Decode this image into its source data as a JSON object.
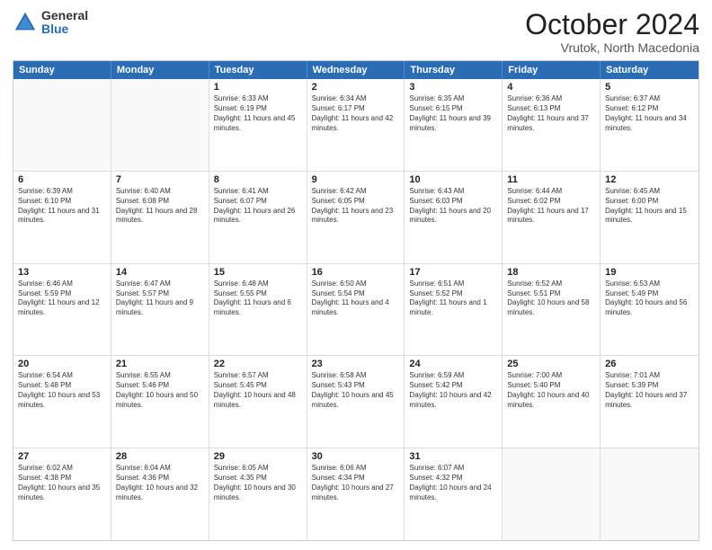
{
  "header": {
    "logo_general": "General",
    "logo_blue": "Blue",
    "title": "October 2024",
    "subtitle": "Vrutok, North Macedonia"
  },
  "calendar": {
    "days": [
      "Sunday",
      "Monday",
      "Tuesday",
      "Wednesday",
      "Thursday",
      "Friday",
      "Saturday"
    ],
    "rows": [
      [
        {
          "day": "",
          "empty": true
        },
        {
          "day": "",
          "empty": true
        },
        {
          "day": "1",
          "sunrise": "Sunrise: 6:33 AM",
          "sunset": "Sunset: 6:19 PM",
          "daylight": "Daylight: 11 hours and 45 minutes."
        },
        {
          "day": "2",
          "sunrise": "Sunrise: 6:34 AM",
          "sunset": "Sunset: 6:17 PM",
          "daylight": "Daylight: 11 hours and 42 minutes."
        },
        {
          "day": "3",
          "sunrise": "Sunrise: 6:35 AM",
          "sunset": "Sunset: 6:15 PM",
          "daylight": "Daylight: 11 hours and 39 minutes."
        },
        {
          "day": "4",
          "sunrise": "Sunrise: 6:36 AM",
          "sunset": "Sunset: 6:13 PM",
          "daylight": "Daylight: 11 hours and 37 minutes."
        },
        {
          "day": "5",
          "sunrise": "Sunrise: 6:37 AM",
          "sunset": "Sunset: 6:12 PM",
          "daylight": "Daylight: 11 hours and 34 minutes."
        }
      ],
      [
        {
          "day": "6",
          "sunrise": "Sunrise: 6:39 AM",
          "sunset": "Sunset: 6:10 PM",
          "daylight": "Daylight: 11 hours and 31 minutes."
        },
        {
          "day": "7",
          "sunrise": "Sunrise: 6:40 AM",
          "sunset": "Sunset: 6:08 PM",
          "daylight": "Daylight: 11 hours and 28 minutes."
        },
        {
          "day": "8",
          "sunrise": "Sunrise: 6:41 AM",
          "sunset": "Sunset: 6:07 PM",
          "daylight": "Daylight: 11 hours and 26 minutes."
        },
        {
          "day": "9",
          "sunrise": "Sunrise: 6:42 AM",
          "sunset": "Sunset: 6:05 PM",
          "daylight": "Daylight: 11 hours and 23 minutes."
        },
        {
          "day": "10",
          "sunrise": "Sunrise: 6:43 AM",
          "sunset": "Sunset: 6:03 PM",
          "daylight": "Daylight: 11 hours and 20 minutes."
        },
        {
          "day": "11",
          "sunrise": "Sunrise: 6:44 AM",
          "sunset": "Sunset: 6:02 PM",
          "daylight": "Daylight: 11 hours and 17 minutes."
        },
        {
          "day": "12",
          "sunrise": "Sunrise: 6:45 AM",
          "sunset": "Sunset: 6:00 PM",
          "daylight": "Daylight: 11 hours and 15 minutes."
        }
      ],
      [
        {
          "day": "13",
          "sunrise": "Sunrise: 6:46 AM",
          "sunset": "Sunset: 5:59 PM",
          "daylight": "Daylight: 11 hours and 12 minutes."
        },
        {
          "day": "14",
          "sunrise": "Sunrise: 6:47 AM",
          "sunset": "Sunset: 5:57 PM",
          "daylight": "Daylight: 11 hours and 9 minutes."
        },
        {
          "day": "15",
          "sunrise": "Sunrise: 6:48 AM",
          "sunset": "Sunset: 5:55 PM",
          "daylight": "Daylight: 11 hours and 6 minutes."
        },
        {
          "day": "16",
          "sunrise": "Sunrise: 6:50 AM",
          "sunset": "Sunset: 5:54 PM",
          "daylight": "Daylight: 11 hours and 4 minutes."
        },
        {
          "day": "17",
          "sunrise": "Sunrise: 6:51 AM",
          "sunset": "Sunset: 5:52 PM",
          "daylight": "Daylight: 11 hours and 1 minute."
        },
        {
          "day": "18",
          "sunrise": "Sunrise: 6:52 AM",
          "sunset": "Sunset: 5:51 PM",
          "daylight": "Daylight: 10 hours and 58 minutes."
        },
        {
          "day": "19",
          "sunrise": "Sunrise: 6:53 AM",
          "sunset": "Sunset: 5:49 PM",
          "daylight": "Daylight: 10 hours and 56 minutes."
        }
      ],
      [
        {
          "day": "20",
          "sunrise": "Sunrise: 6:54 AM",
          "sunset": "Sunset: 5:48 PM",
          "daylight": "Daylight: 10 hours and 53 minutes."
        },
        {
          "day": "21",
          "sunrise": "Sunrise: 6:55 AM",
          "sunset": "Sunset: 5:46 PM",
          "daylight": "Daylight: 10 hours and 50 minutes."
        },
        {
          "day": "22",
          "sunrise": "Sunrise: 6:57 AM",
          "sunset": "Sunset: 5:45 PM",
          "daylight": "Daylight: 10 hours and 48 minutes."
        },
        {
          "day": "23",
          "sunrise": "Sunrise: 6:58 AM",
          "sunset": "Sunset: 5:43 PM",
          "daylight": "Daylight: 10 hours and 45 minutes."
        },
        {
          "day": "24",
          "sunrise": "Sunrise: 6:59 AM",
          "sunset": "Sunset: 5:42 PM",
          "daylight": "Daylight: 10 hours and 42 minutes."
        },
        {
          "day": "25",
          "sunrise": "Sunrise: 7:00 AM",
          "sunset": "Sunset: 5:40 PM",
          "daylight": "Daylight: 10 hours and 40 minutes."
        },
        {
          "day": "26",
          "sunrise": "Sunrise: 7:01 AM",
          "sunset": "Sunset: 5:39 PM",
          "daylight": "Daylight: 10 hours and 37 minutes."
        }
      ],
      [
        {
          "day": "27",
          "sunrise": "Sunrise: 6:02 AM",
          "sunset": "Sunset: 4:38 PM",
          "daylight": "Daylight: 10 hours and 35 minutes."
        },
        {
          "day": "28",
          "sunrise": "Sunrise: 6:04 AM",
          "sunset": "Sunset: 4:36 PM",
          "daylight": "Daylight: 10 hours and 32 minutes."
        },
        {
          "day": "29",
          "sunrise": "Sunrise: 6:05 AM",
          "sunset": "Sunset: 4:35 PM",
          "daylight": "Daylight: 10 hours and 30 minutes."
        },
        {
          "day": "30",
          "sunrise": "Sunrise: 6:06 AM",
          "sunset": "Sunset: 4:34 PM",
          "daylight": "Daylight: 10 hours and 27 minutes."
        },
        {
          "day": "31",
          "sunrise": "Sunrise: 6:07 AM",
          "sunset": "Sunset: 4:32 PM",
          "daylight": "Daylight: 10 hours and 24 minutes."
        },
        {
          "day": "",
          "empty": true
        },
        {
          "day": "",
          "empty": true
        }
      ]
    ]
  }
}
